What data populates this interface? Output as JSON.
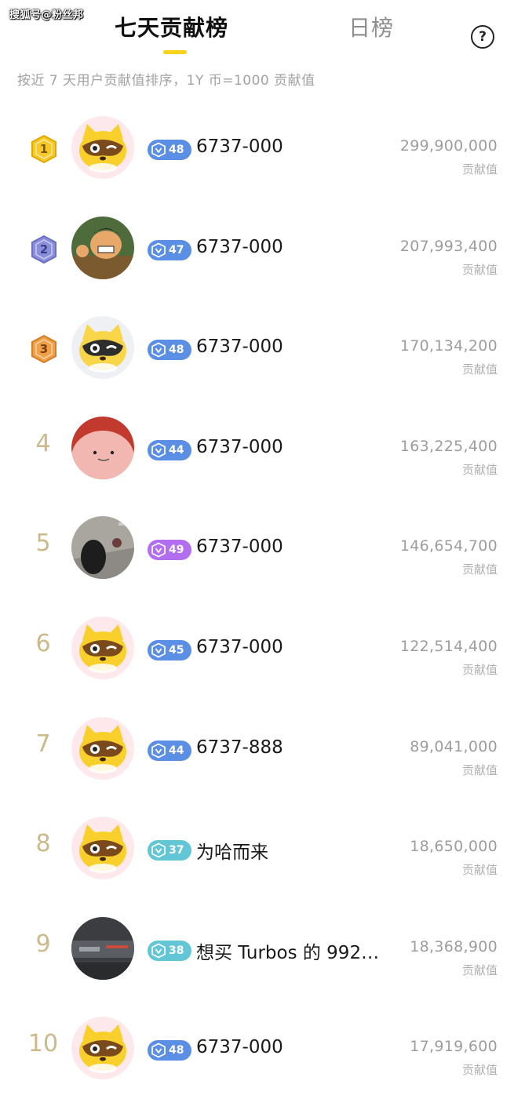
{
  "watermark": "搜狐号@粉丝邦",
  "tabs": [
    {
      "label": "七天贡献榜",
      "active": true
    },
    {
      "label": "日榜",
      "active": false
    }
  ],
  "help_icon": {
    "symbol": "?",
    "icon": "question-circle-icon"
  },
  "subtitle": "按近 7 天用户贡献值排序，1Y 币=1000 贡献值",
  "colors": {
    "accent": "#f7d21a",
    "level_blue": "#5b8fe6",
    "level_purple": "#b36df0",
    "level_teal": "#62c6d6",
    "gold": "#f6c92b",
    "silver": "#8b8fd9",
    "bronze": "#f0a048"
  },
  "leaderboard": [
    {
      "rank": "1",
      "medal": "gold",
      "avatar": "raccoon-yellow",
      "level": "48",
      "level_color": "blue",
      "name": "6737-000",
      "score": "299,900,000",
      "score_label": "贡献值"
    },
    {
      "rank": "2",
      "medal": "silver",
      "avatar": "cartoon-photo",
      "level": "47",
      "level_color": "blue",
      "name": "6737-000",
      "score": "207,993,400",
      "score_label": "贡献值"
    },
    {
      "rank": "3",
      "medal": "bronze",
      "avatar": "raccoon-grey",
      "level": "48",
      "level_color": "blue",
      "name": "6737-000",
      "score": "170,134,200",
      "score_label": "贡献值"
    },
    {
      "rank": "4",
      "medal": "",
      "avatar": "pink-blob",
      "level": "44",
      "level_color": "blue",
      "name": "6737-000",
      "score": "163,225,400",
      "score_label": "贡献值"
    },
    {
      "rank": "5",
      "medal": "",
      "avatar": "photo-street",
      "level": "49",
      "level_color": "purple",
      "name": "6737-000",
      "score": "146,654,700",
      "score_label": "贡献值"
    },
    {
      "rank": "6",
      "medal": "",
      "avatar": "raccoon-yellow",
      "level": "45",
      "level_color": "blue",
      "name": "6737-000",
      "score": "122,514,400",
      "score_label": "贡献值"
    },
    {
      "rank": "7",
      "medal": "",
      "avatar": "raccoon-yellow",
      "level": "44",
      "level_color": "blue",
      "name": "6737-888",
      "score": "89,041,000",
      "score_label": "贡献值"
    },
    {
      "rank": "8",
      "medal": "",
      "avatar": "raccoon-yellow",
      "level": "37",
      "level_color": "teal",
      "name": "为哈而来",
      "score": "18,650,000",
      "score_label": "贡献值"
    },
    {
      "rank": "9",
      "medal": "",
      "avatar": "photo-car",
      "level": "38",
      "level_color": "teal",
      "name": "想买 Turbos 的 992…",
      "score": "18,368,900",
      "score_label": "贡献值"
    },
    {
      "rank": "10",
      "medal": "",
      "avatar": "raccoon-yellow",
      "level": "48",
      "level_color": "blue",
      "name": "6737-000",
      "score": "17,919,600",
      "score_label": "贡献值"
    }
  ]
}
